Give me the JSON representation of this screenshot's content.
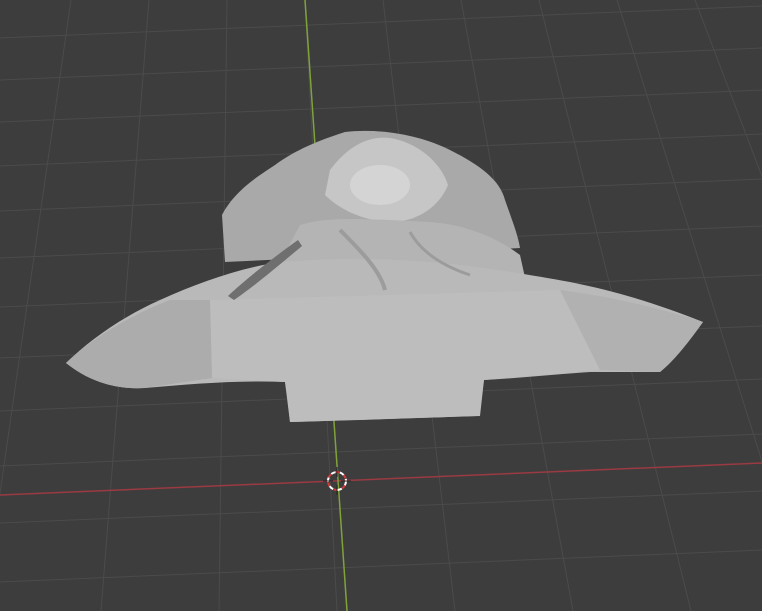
{
  "viewport": {
    "type": "3d-viewport",
    "colors": {
      "background": "#3d3d3d",
      "grid": "#4b4b4b",
      "x_axis": "#9a3a42",
      "y_axis": "#7fa33a",
      "mesh": "#b9b9b9",
      "mesh_shadow": "#8f8f8f",
      "mesh_highlight": "#d2d2d2"
    },
    "icons": [
      "3d-cursor-icon"
    ],
    "object": "sculpted-bust-mesh"
  }
}
